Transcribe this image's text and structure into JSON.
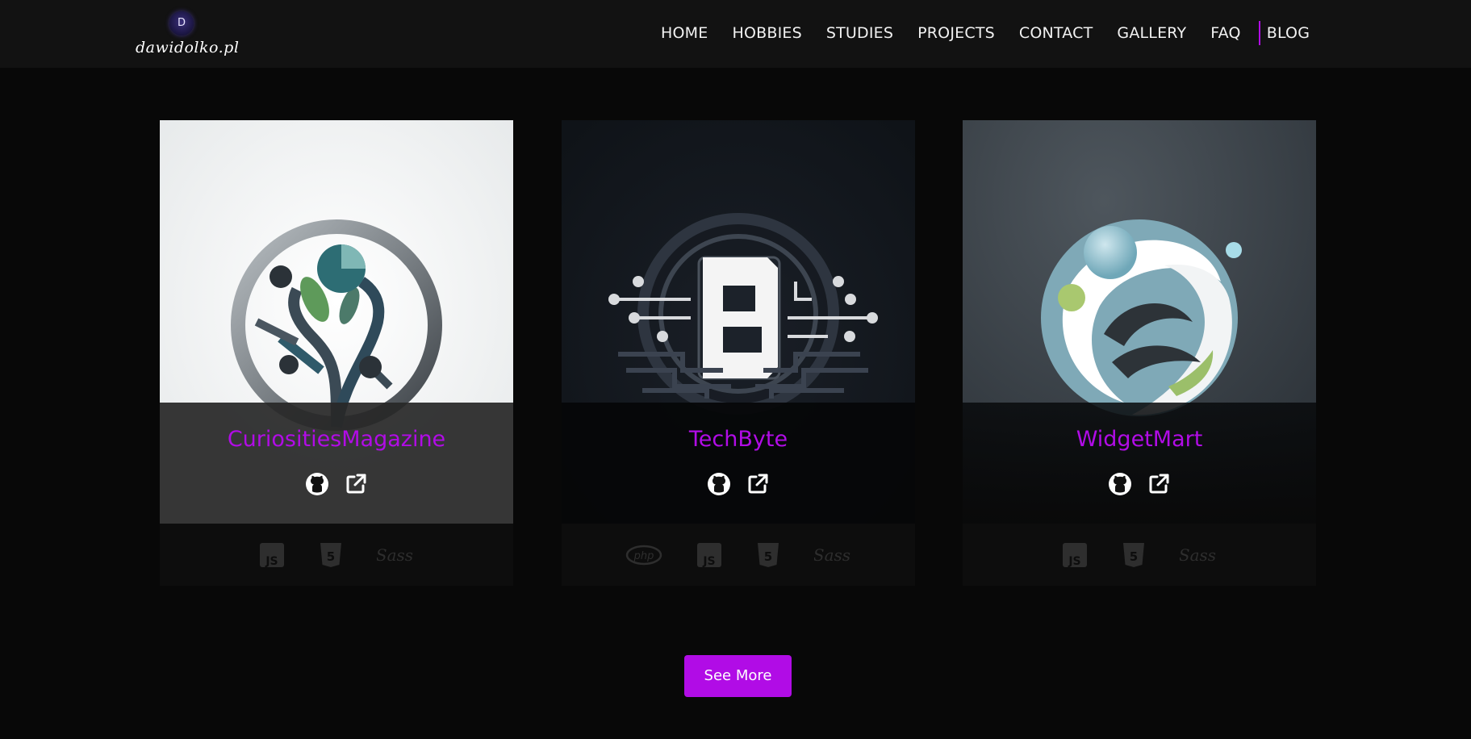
{
  "header": {
    "logo_initial": "D",
    "logo_text": "dawidolko.pl",
    "nav": [
      "HOME",
      "HOBBIES",
      "STUDIES",
      "PROJECTS",
      "CONTACT",
      "GALLERY",
      "FAQ"
    ],
    "nav_last": "BLOG",
    "accent": "#b10ce6"
  },
  "projects": [
    {
      "title": "CuriositiesMagazine",
      "links": [
        "github-icon",
        "external-link-icon"
      ],
      "tech": [
        "JS",
        "HTML5",
        "Sass"
      ]
    },
    {
      "title": "TechByte",
      "links": [
        "github-icon",
        "external-link-icon"
      ],
      "tech": [
        "php",
        "JS",
        "HTML5",
        "Sass"
      ]
    },
    {
      "title": "WidgetMart",
      "links": [
        "github-icon",
        "external-link-icon"
      ],
      "tech": [
        "JS",
        "HTML5",
        "Sass"
      ]
    }
  ],
  "see_more_label": "See More"
}
